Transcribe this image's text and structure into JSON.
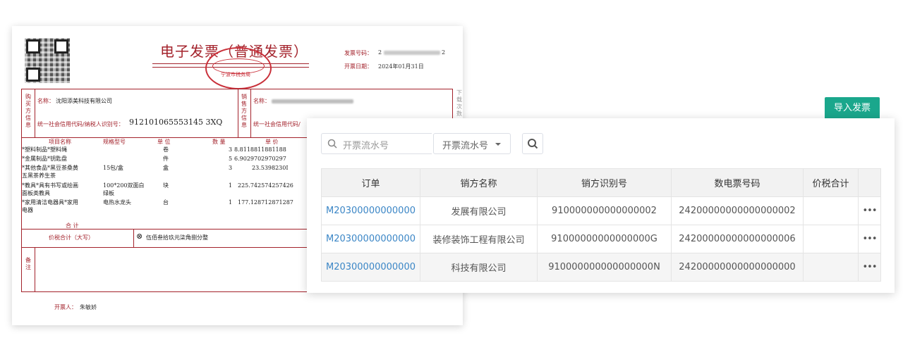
{
  "invoice": {
    "title": "电子发票（普通发票）",
    "invoice_no_label": "发票号码：",
    "invoice_no_prefix": "2",
    "invoice_no_suffix": "2",
    "date_label": "开票日期：",
    "date_value": "2024年01月31日",
    "buyer_side_label": "购买方信息",
    "buyer_name_label": "名称：",
    "buyer_name": "沈阳添美科技有限公司",
    "buyer_tax_label": "统一社会信用代码/纳税人识别号：",
    "buyer_tax_id": "912101065553145 3XQ",
    "seller_side_label": "销售方信息",
    "seller_name_label": "名称：",
    "seller_tax_label": "统一社会信用代码/",
    "col_item": "项目名称",
    "col_spec": "规格型号",
    "col_unit": "单 位",
    "col_qty": "数 量",
    "col_price": "单 价",
    "items": [
      {
        "name": "*塑料制品*塑料绳",
        "spec": "",
        "unit": "卷",
        "qty": "3",
        "price": "8.8118811881188"
      },
      {
        "name": "*金属制品*钥匙盘",
        "spec": "",
        "unit": "件",
        "qty": "5",
        "price": "6.9029702970297"
      },
      {
        "name": "*其他食品*黑豆茶桑黄",
        "name2": "五黑茶养生茶",
        "spec": "15包/盒",
        "unit": "盒",
        "qty": "3",
        "price": "23.5398230I"
      },
      {
        "name": "*教具*具有书写或绘画",
        "name2": "面板类教具",
        "spec": "100*200双面白",
        "spec2": "绿板",
        "unit": "块",
        "qty": "1",
        "price": "225.742574257426"
      },
      {
        "name": "*家用清洁电器具*家用",
        "name2": "电器",
        "spec": "电热水龙头",
        "unit": "台",
        "qty": "1",
        "price": "177.128712871287"
      }
    ],
    "total_label": "合 计",
    "tax_total_label": "价税合计（大写）",
    "tax_total_value": "伍佰叁拾玖元柒角捌分整",
    "remark_label": "备注",
    "issuer_label": "开票人：",
    "issuer_name": "朱敏娇",
    "side_note": "下载次数：",
    "seal_text": "宁波市税务局"
  },
  "panel": {
    "import_button": "导入发票",
    "search_placeholder": "开票流水号",
    "search_select_value": "开票流水号",
    "table": {
      "headers": [
        "订单",
        "销方名称",
        "销方识别号",
        "数电票号码",
        "价税合计"
      ],
      "rows": [
        {
          "order": "M20300000000000",
          "seller": "发展有限公司",
          "seller_id": "910000000000000002",
          "invoice_no": "24200000000000000002",
          "amount": ""
        },
        {
          "order": "M20300000000000",
          "seller": "装修装饰工程有限公司",
          "seller_id": "91000000000000000G",
          "invoice_no": "24200000000000000006",
          "amount": ""
        },
        {
          "order": "M20300000000000",
          "seller": "科技有限公司",
          "seller_id": "910000000000000000N",
          "invoice_no": "24200000000000000000",
          "amount": ""
        }
      ],
      "more_label": "•••"
    }
  },
  "colors": {
    "accent": "#1aa78c",
    "link": "#3b86c6",
    "invoice_red": "#a3222b"
  }
}
